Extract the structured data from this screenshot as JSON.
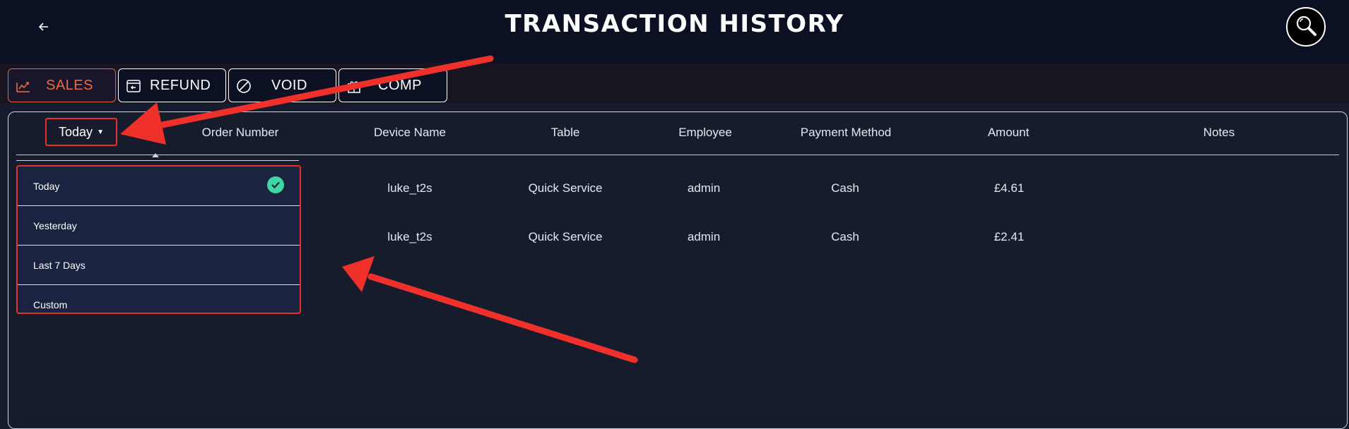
{
  "header": {
    "title": "TRANSACTION HISTORY",
    "back_icon": "arrow-left-icon",
    "search_icon": "magnifier-icon"
  },
  "tabs": [
    {
      "label": "SALES",
      "icon": "sales-chart-icon",
      "active": true
    },
    {
      "label": "REFUND",
      "icon": "refund-icon",
      "active": false
    },
    {
      "label": "VOID",
      "icon": "void-circle-slash-icon",
      "active": false
    },
    {
      "label": "COMP",
      "icon": "gift-icon",
      "active": false
    }
  ],
  "filter": {
    "selected": "Today",
    "options": [
      "Today",
      "Yesterday",
      "Last 7 Days",
      "Custom"
    ]
  },
  "table": {
    "columns": [
      "Order Number",
      "Device Name",
      "Table",
      "Employee",
      "Payment Method",
      "Amount",
      "Notes"
    ],
    "rows": [
      {
        "device": "luke_t2s",
        "table": "Quick Service",
        "employee": "admin",
        "payment": "Cash",
        "amount": "£4.61",
        "notes": ""
      },
      {
        "device": "luke_t2s",
        "table": "Quick Service",
        "employee": "admin",
        "payment": "Cash",
        "amount": "£2.41",
        "notes": ""
      }
    ]
  },
  "colors": {
    "accent": "#ec6a3e",
    "annotation": "#e8302a",
    "check": "#3ed6a3",
    "background": "#161b2e",
    "header": "#0b1122"
  }
}
